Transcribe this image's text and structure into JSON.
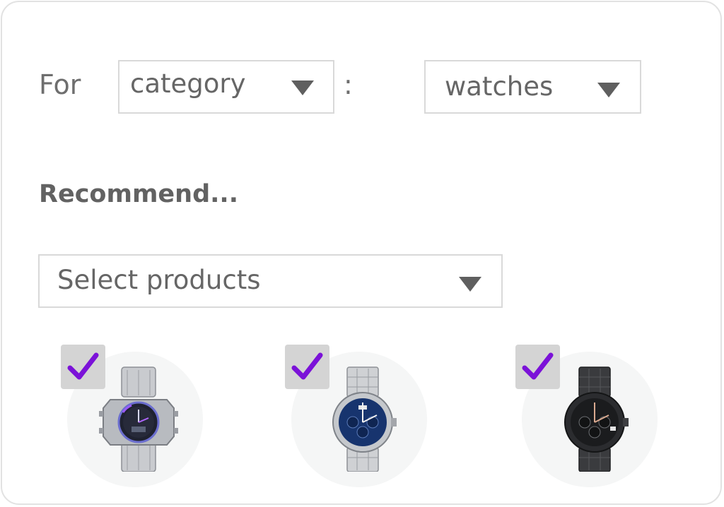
{
  "filter": {
    "for_label": "For",
    "separator": ":",
    "attribute_select": {
      "value": "category",
      "icon": "caret-down-icon"
    },
    "value_select": {
      "value": "watches",
      "icon": "caret-down-icon"
    }
  },
  "recommend": {
    "heading": "Recommend...",
    "products_select": {
      "placeholder": "Select products",
      "icon": "caret-down-icon"
    }
  },
  "products": [
    {
      "checked": true,
      "check_icon": "checkmark-icon",
      "image": "silver-digital-analog-watch"
    },
    {
      "checked": true,
      "check_icon": "checkmark-icon",
      "image": "blue-dial-chronograph-watch"
    },
    {
      "checked": true,
      "check_icon": "checkmark-icon",
      "image": "black-chronograph-watch"
    }
  ],
  "colors": {
    "check_mark": "#7b12d8",
    "text": "#6b6b6b",
    "border": "#d9d9d9"
  }
}
